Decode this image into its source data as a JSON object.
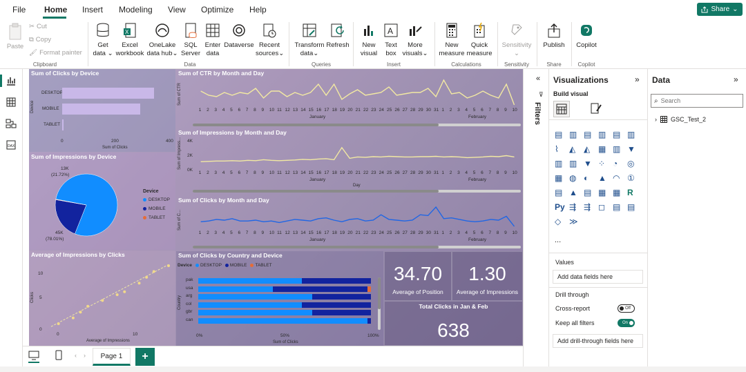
{
  "menu": {
    "items": [
      "File",
      "Home",
      "Insert",
      "Modeling",
      "View",
      "Optimize",
      "Help"
    ],
    "share_label": "Share"
  },
  "ribbon": {
    "clipboard": {
      "paste": "Paste",
      "cut": "Cut",
      "copy": "Copy",
      "format_painter": "Format painter",
      "group": "Clipboard"
    },
    "data": {
      "get_data": [
        "Get",
        "data"
      ],
      "excel": [
        "Excel",
        "workbook"
      ],
      "onelake": [
        "OneLake",
        "data hub"
      ],
      "sql": [
        "SQL",
        "Server"
      ],
      "enter": [
        "Enter",
        "data"
      ],
      "dataverse": [
        "Dataverse",
        ""
      ],
      "recent": [
        "Recent",
        "sources"
      ],
      "group": "Data"
    },
    "queries": {
      "transform": [
        "Transform",
        "data"
      ],
      "refresh": [
        "Refresh",
        ""
      ],
      "group": "Queries"
    },
    "insert": {
      "new_visual": [
        "New",
        "visual"
      ],
      "text_box": [
        "Text",
        "box"
      ],
      "more_visuals": [
        "More",
        "visuals"
      ],
      "group": "Insert"
    },
    "calculations": {
      "new_measure": [
        "New",
        "measure"
      ],
      "quick_measure": [
        "Quick",
        "measure"
      ],
      "group": "Calculations"
    },
    "sensitivity": {
      "label": "Sensitivity",
      "group": "Sensitivity"
    },
    "share": {
      "publish": "Publish",
      "group": "Share"
    },
    "copilot": {
      "label": "Copilot",
      "group": "Copilot"
    }
  },
  "visuals": {
    "clicks_by_device": {
      "title": "Sum of Clicks by Device",
      "ylabel": "Device",
      "xlabel": "Sum of Clicks",
      "ticks": [
        "0",
        "200",
        "400"
      ]
    },
    "impressions_by_device": {
      "title": "Sum of Impressions by Device",
      "legend_title": "Device",
      "legend": [
        "DESKTOP",
        "MOBILE",
        "TABLET"
      ],
      "label_mobile": "13K",
      "label_mobile_pct": "(21.72%)",
      "label_desktop": "45K",
      "label_desktop_pct": "(78.01%)"
    },
    "avg_impr_by_clicks": {
      "title": "Average of Impressions by Clicks",
      "xlabel": "Average of Impressions",
      "ylabel": "Clicks",
      "yticks": [
        "10",
        "5",
        "0"
      ],
      "xticks": [
        "0",
        "10"
      ]
    },
    "ctr_by_month": {
      "title": "Sum of CTR by Month and Day",
      "ylabel": "Sum of CTR"
    },
    "impr_by_month": {
      "title": "Sum of Impressions by Month and Day",
      "ylabel": "Sum of Impress...",
      "yticks": [
        "4K",
        "2K",
        "0K"
      ],
      "xlabel": "Day"
    },
    "clicks_by_month": {
      "title": "Sum of Clicks by Month and Day",
      "ylabel": "Sum of C..."
    },
    "months": [
      "January",
      "February"
    ],
    "day_labels": [
      "1",
      "2",
      "3",
      "4",
      "5",
      "6",
      "7",
      "8",
      "9",
      "10",
      "11",
      "12",
      "13",
      "14",
      "15",
      "16",
      "17",
      "18",
      "19",
      "20",
      "21",
      "22",
      "23",
      "24",
      "25",
      "26",
      "27",
      "28",
      "29",
      "30",
      "31",
      "1",
      "2",
      "3",
      "4",
      "5",
      "6",
      "7",
      "8",
      "9",
      "10"
    ],
    "clicks_by_country": {
      "title": "Sum of Clicks by Country and Device",
      "legend_title": "Device",
      "legend": [
        "DESKTOP",
        "MOBILE",
        "TABLET"
      ],
      "ylabel": "Country",
      "xlabel": "Sum of Clicks",
      "xticks": [
        "0%",
        "50%",
        "100%"
      ]
    },
    "card_position": {
      "value": "34.70",
      "label": "Average of Position"
    },
    "card_impressions": {
      "value": "1.30",
      "label": "Average of Impressions"
    },
    "card_total": {
      "title": "Total Clicks in Jan & Feb",
      "value": "638"
    }
  },
  "chart_data": [
    {
      "type": "bar",
      "title": "Sum of Clicks by Device",
      "categories": [
        "DESKTOP",
        "MOBILE",
        "TABLET"
      ],
      "values": [
        340,
        290,
        5
      ],
      "xlabel": "Sum of Clicks",
      "ylabel": "Device",
      "xlim": [
        0,
        400
      ]
    },
    {
      "type": "pie",
      "title": "Sum of Impressions by Device",
      "categories": [
        "DESKTOP",
        "MOBILE",
        "TABLET"
      ],
      "values": [
        78.01,
        21.72,
        0.27
      ]
    },
    {
      "type": "scatter",
      "title": "Average of Impressions by Clicks",
      "xlabel": "Average of Impressions",
      "ylabel": "Clicks",
      "x": [
        1,
        3,
        4,
        5,
        7,
        9,
        10,
        12,
        13,
        14,
        16
      ],
      "y": [
        0,
        1,
        2,
        3,
        4,
        5,
        5.5,
        7,
        8,
        9,
        10
      ],
      "ylim": [
        0,
        10
      ],
      "xlim": [
        0,
        16
      ]
    },
    {
      "type": "line",
      "title": "Sum of CTR by Month and Day",
      "ylabel": "Sum of CTR",
      "values": [
        0.6,
        0.45,
        0.4,
        0.55,
        0.45,
        0.55,
        0.5,
        0.7,
        0.35,
        0.6,
        0.6,
        0.4,
        0.55,
        0.45,
        0.55,
        0.85,
        0.45,
        0.85,
        0.3,
        0.5,
        0.65,
        0.45,
        0.5,
        0.55,
        0.75,
        0.45,
        0.5,
        0.55,
        0.55,
        0.7,
        0.4,
        1.0,
        0.5,
        0.55,
        0.35,
        0.45,
        0.6,
        0.45,
        0.35,
        0.85,
        0.1
      ]
    },
    {
      "type": "line",
      "title": "Sum of Impressions by Month and Day",
      "ylabel": "Sum of Impressions",
      "xlabel": "Day",
      "yticks": [
        "0K",
        "2K",
        "4K"
      ],
      "values": [
        1100,
        1150,
        1200,
        1200,
        1250,
        1200,
        1300,
        1250,
        1400,
        1300,
        1250,
        1300,
        1350,
        1450,
        1400,
        1500,
        1550,
        1400,
        3200,
        1600,
        1800,
        1750,
        1850,
        1800,
        1900,
        1850,
        1800,
        1800,
        1850,
        1850,
        1900,
        1800,
        1850,
        1800,
        1700,
        1750,
        1800,
        1900,
        1850,
        2000,
        1800
      ],
      "ylim": [
        0,
        4000
      ]
    },
    {
      "type": "line",
      "title": "Sum of Clicks by Month and Day",
      "ylabel": "Sum of Clicks",
      "values": [
        11,
        12,
        14,
        13,
        15,
        12,
        12,
        13,
        11,
        12,
        10,
        12,
        14,
        13,
        12,
        15,
        16,
        13,
        11,
        14,
        15,
        12,
        13,
        20,
        14,
        13,
        12,
        13,
        20,
        19,
        30,
        15,
        16,
        14,
        12,
        11,
        12,
        14,
        13,
        18,
        5
      ]
    },
    {
      "type": "bar",
      "title": "Sum of Clicks by Country and Device",
      "categories": [
        "pak",
        "usa",
        "arg",
        "col",
        "gbr",
        "can"
      ],
      "series": [
        {
          "name": "DESKTOP",
          "values": [
            60,
            43,
            66,
            60,
            66,
            98
          ]
        },
        {
          "name": "MOBILE",
          "values": [
            40,
            55,
            34,
            40,
            34,
            2
          ]
        },
        {
          "name": "TABLET",
          "values": [
            0,
            2,
            0,
            0,
            0,
            0
          ]
        }
      ],
      "xlabel": "Sum of Clicks",
      "ylabel": "Country"
    }
  ],
  "page_tab": {
    "label": "Page 1",
    "add": "+"
  },
  "filters": {
    "label": "Filters"
  },
  "viz_pane": {
    "title": "Visualizations",
    "build": "Build visual",
    "values_label": "Values",
    "add_data": "Add data fields here",
    "drill": "Drill through",
    "cross_report": "Cross-report",
    "cross_state": "Off",
    "keep_filters": "Keep all filters",
    "keep_state": "On",
    "add_drill": "Add drill-through fields here",
    "more": "..."
  },
  "data_pane": {
    "title": "Data",
    "search_placeholder": "Search",
    "table": "GSC_Test_2"
  },
  "colors": {
    "accent": "#117865",
    "desktop": "#118dff",
    "mobile": "#12239e",
    "tablet": "#e66c37",
    "line_ctr": "#f2e9a2",
    "line_clicks": "#1f66e5",
    "bar_device": "#c9b8e8"
  }
}
